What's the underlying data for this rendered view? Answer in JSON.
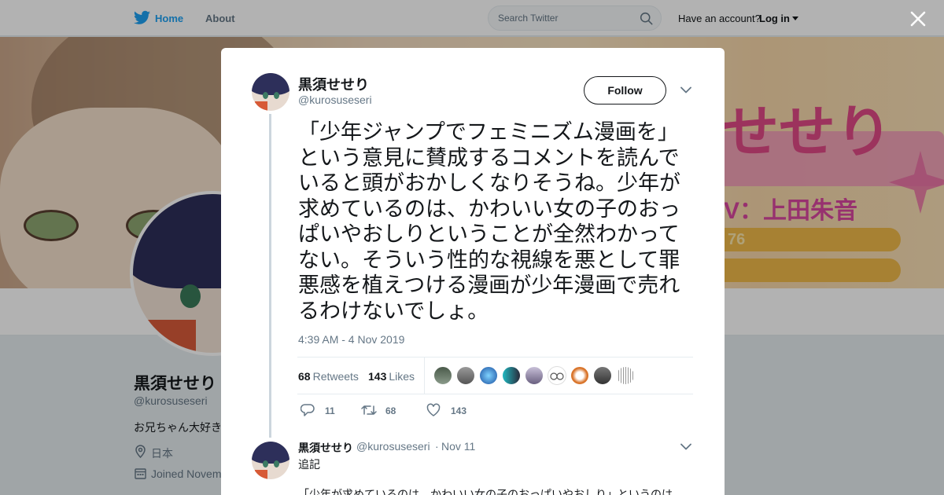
{
  "topbar": {
    "home_label": "Home",
    "about_label": "About",
    "search_placeholder": "Search Twitter",
    "have_account": "Have an account?",
    "login_label": "Log in",
    "brand_color": "#1da1f2"
  },
  "banner": {
    "title_text": "せせり",
    "credit_text": "V：上田朱音",
    "pill_text": "76"
  },
  "profile": {
    "name": "黒須せせり",
    "handle": "@kurosuseseri",
    "bio": "お兄ちゃん大好き",
    "location": "日本",
    "joined": "Joined Novem"
  },
  "tweet": {
    "name": "黒須せせり",
    "handle": "@kurosuseseri",
    "follow_label": "Follow",
    "text": "「少年ジャンプでフェミニズム漫画を」という意見に賛成するコメントを読んでいると頭がおかしくなりそうね。少年が求めているのは、かわいい女の子のおっぱいやおしりということが全然わかってない。そういう性的な視線を悪として罪悪感を植えつける漫画が少年漫画で売れるわけないでしょ。",
    "timestamp": "4:39 AM - 4 Nov 2019",
    "retweets_count": "68",
    "retweets_label": "Retweets",
    "likes_count": "143",
    "likes_label": "Likes",
    "reply_action_count": "11",
    "retweet_action_count": "68",
    "like_action_count": "143"
  },
  "reply": {
    "name": "黒須せせり",
    "handle": "@kurosuseseri",
    "separator": "·",
    "date": "Nov 11",
    "text": "追記",
    "text2": "「少年が求めているのは、かわいい女の子のおっぱいやおしり」というのは"
  }
}
